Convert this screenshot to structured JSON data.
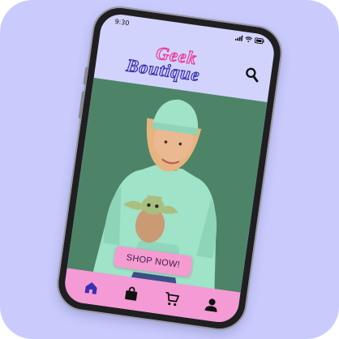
{
  "status_bar": {
    "time": "9:30"
  },
  "header": {
    "logo_line1": "Geek",
    "logo_line2": "Boutique",
    "search_icon": "search-icon"
  },
  "hero": {
    "cta_label": "SHOP NOW!"
  },
  "bottom_nav": {
    "items": [
      {
        "icon": "home-icon",
        "active": true
      },
      {
        "icon": "shopping-bag-icon",
        "active": false
      },
      {
        "icon": "cart-icon",
        "active": false
      },
      {
        "icon": "profile-icon",
        "active": false
      }
    ]
  },
  "colors": {
    "background": "#c9cbfd",
    "screen": "#d2d3fc",
    "accent_pink": "#f49ad5",
    "logo_pink": "#ea3b96",
    "logo_blue": "#3a2fb0",
    "active_nav": "#3a2fb0",
    "hero_green": "#4d8468",
    "hoodie_mint": "#9fe3c8"
  }
}
